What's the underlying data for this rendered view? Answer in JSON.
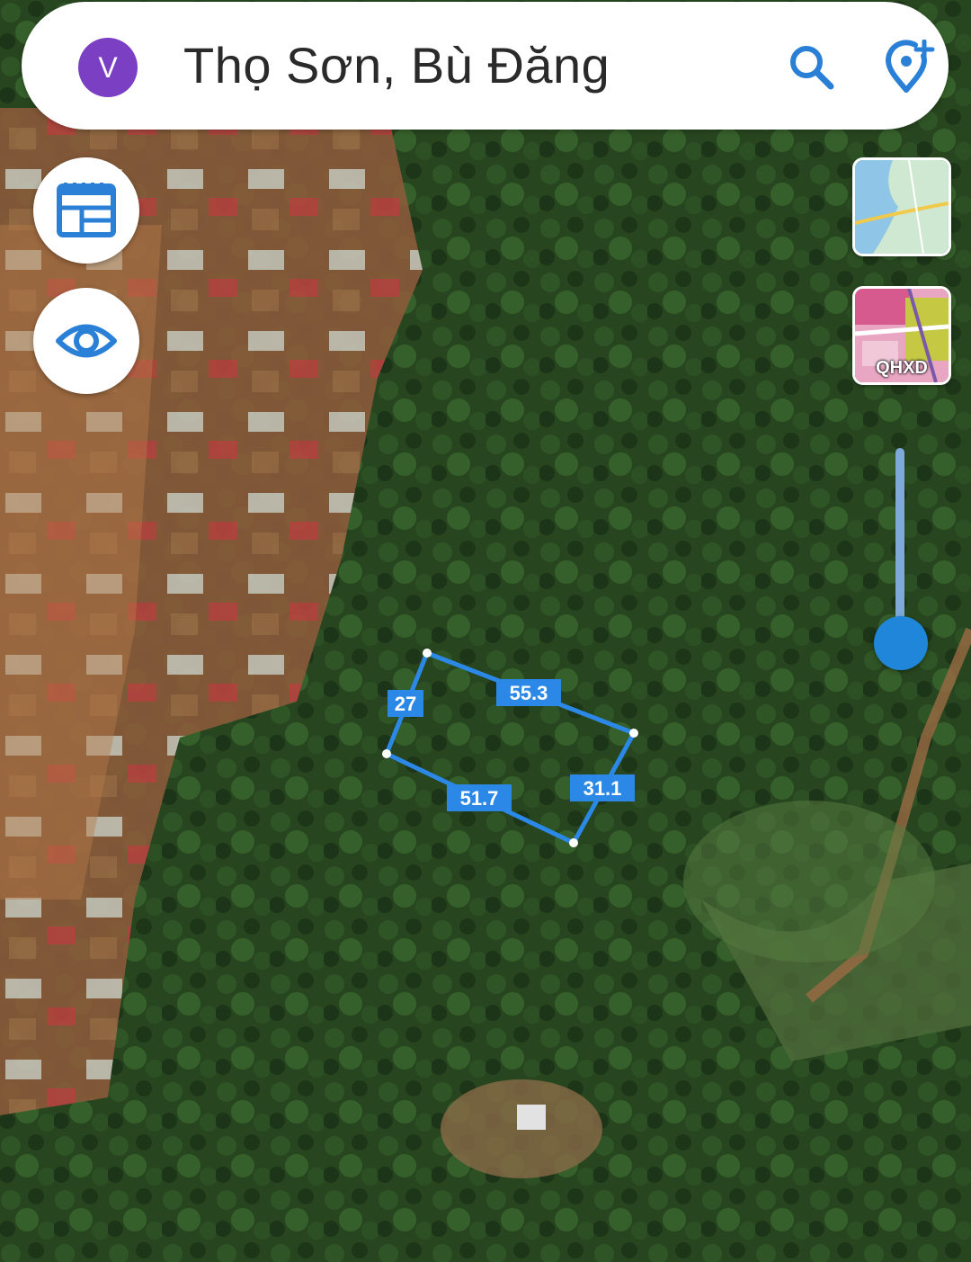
{
  "search": {
    "avatar_letter": "V",
    "title": "Thọ Sơn, Bù Đăng"
  },
  "layers": {
    "qhxd_label": "QHXD"
  },
  "zoom": {
    "level_fraction": 1.0
  },
  "parcel": {
    "edge_lengths": [
      "55.3",
      "31.1",
      "51.7",
      "27"
    ],
    "line_color": "#2c88e6"
  },
  "icons": [
    "search-icon",
    "add-location-pin-icon",
    "calendar-icon",
    "eye-icon"
  ]
}
